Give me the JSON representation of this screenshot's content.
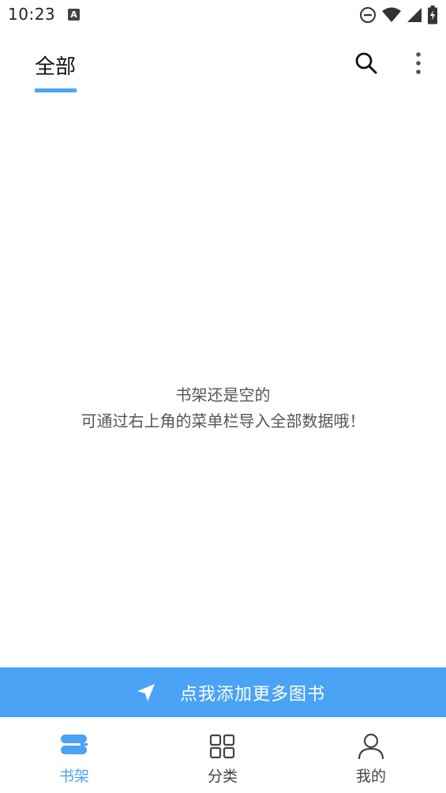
{
  "status_bar": {
    "time": "10:23",
    "notification_icon_letter": "A",
    "icons": [
      "dnd-icon",
      "wifi-icon",
      "signal-icon",
      "battery-charging-icon"
    ]
  },
  "header": {
    "tab_label": "全部",
    "accent_color": "#4aa3f5",
    "actions": [
      "search-icon",
      "more-vert-icon"
    ]
  },
  "empty_state": {
    "line1": "书架还是空的",
    "line2": "可通过右上角的菜单栏导入全部数据哦！"
  },
  "add_banner": {
    "label": "点我添加更多图书",
    "icon": "navigation-arrow-icon",
    "color": "#4aa3f5"
  },
  "bottom_nav": {
    "items": [
      {
        "label": "书架",
        "icon": "bookshelf-icon",
        "active": true
      },
      {
        "label": "分类",
        "icon": "grid-icon",
        "active": false
      },
      {
        "label": "我的",
        "icon": "person-icon",
        "active": false
      }
    ]
  }
}
